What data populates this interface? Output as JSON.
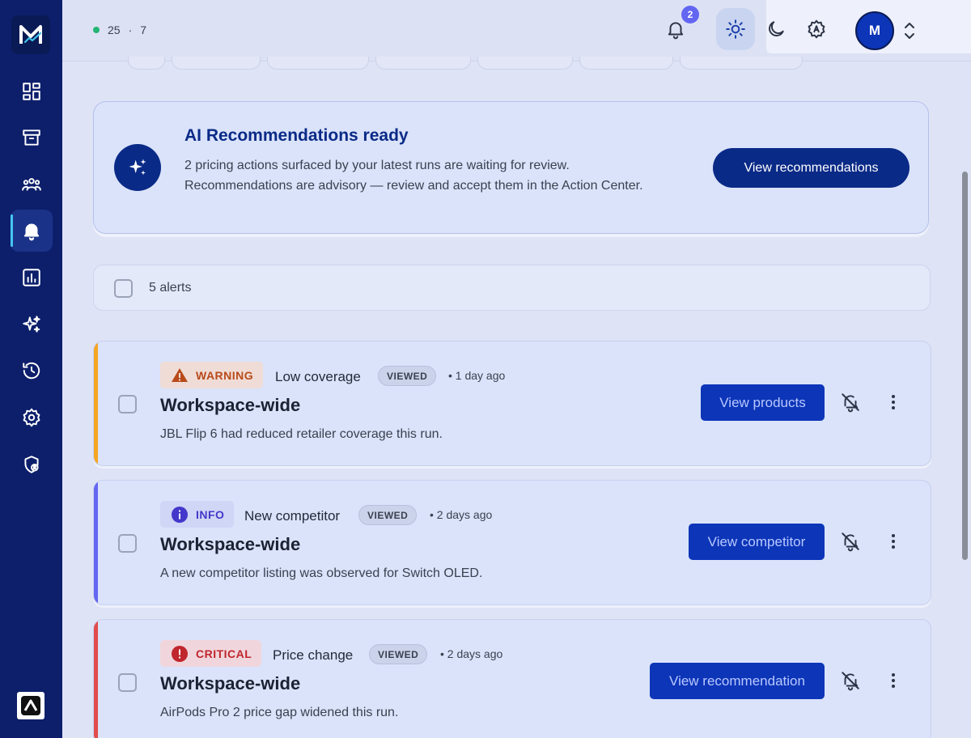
{
  "topbar": {
    "status_count_a": "25",
    "status_sep": "·",
    "status_count_b": "7",
    "notifications_count": "2",
    "avatar_initial": "M"
  },
  "sidebar": {
    "items": [
      {
        "name": "dashboard",
        "icon": "dashboard-icon"
      },
      {
        "name": "archive",
        "icon": "archive-icon"
      },
      {
        "name": "team",
        "icon": "team-icon"
      },
      {
        "name": "alerts",
        "icon": "bell-icon",
        "active": true
      },
      {
        "name": "reports",
        "icon": "chart-icon"
      },
      {
        "name": "ai",
        "icon": "sparkles-icon"
      },
      {
        "name": "history",
        "icon": "history-icon"
      },
      {
        "name": "settings",
        "icon": "gear-icon"
      },
      {
        "name": "security",
        "icon": "shield-user-icon"
      }
    ]
  },
  "banner": {
    "title": "AI Recommendations ready",
    "text": "2 pricing actions surfaced by your latest runs are waiting for review. Recommendations are advisory — review and accept them in the Action Center.",
    "button": "View recommendations"
  },
  "selection": {
    "count_label": "5 alerts"
  },
  "alerts": [
    {
      "severity": "WARNING",
      "severity_color": "#b84a1a",
      "severity_bg": "#f0dcd6",
      "stripe": "#f5a623",
      "type": "Low coverage",
      "viewed": "VIEWED",
      "ago": "• 1 day ago",
      "title": "Workspace-wide",
      "description": "JBL Flip 6 had reduced retailer coverage this run.",
      "action": "View products"
    },
    {
      "severity": "INFO",
      "severity_color": "#4338ca",
      "severity_bg": "#cfd6f6",
      "stripe": "#6366f1",
      "type": "New competitor",
      "viewed": "VIEWED",
      "ago": "• 2 days ago",
      "title": "Workspace-wide",
      "description": "A new competitor listing was observed for Switch OLED.",
      "action": "View competitor"
    },
    {
      "severity": "CRITICAL",
      "severity_color": "#c0262d",
      "severity_bg": "#f0d6dc",
      "stripe": "#e24b4b",
      "type": "Price change",
      "viewed": "VIEWED",
      "ago": "• 2 days ago",
      "title": "Workspace-wide",
      "description": "AirPods Pro 2 price gap widened this run.",
      "action": "View recommendation"
    }
  ]
}
